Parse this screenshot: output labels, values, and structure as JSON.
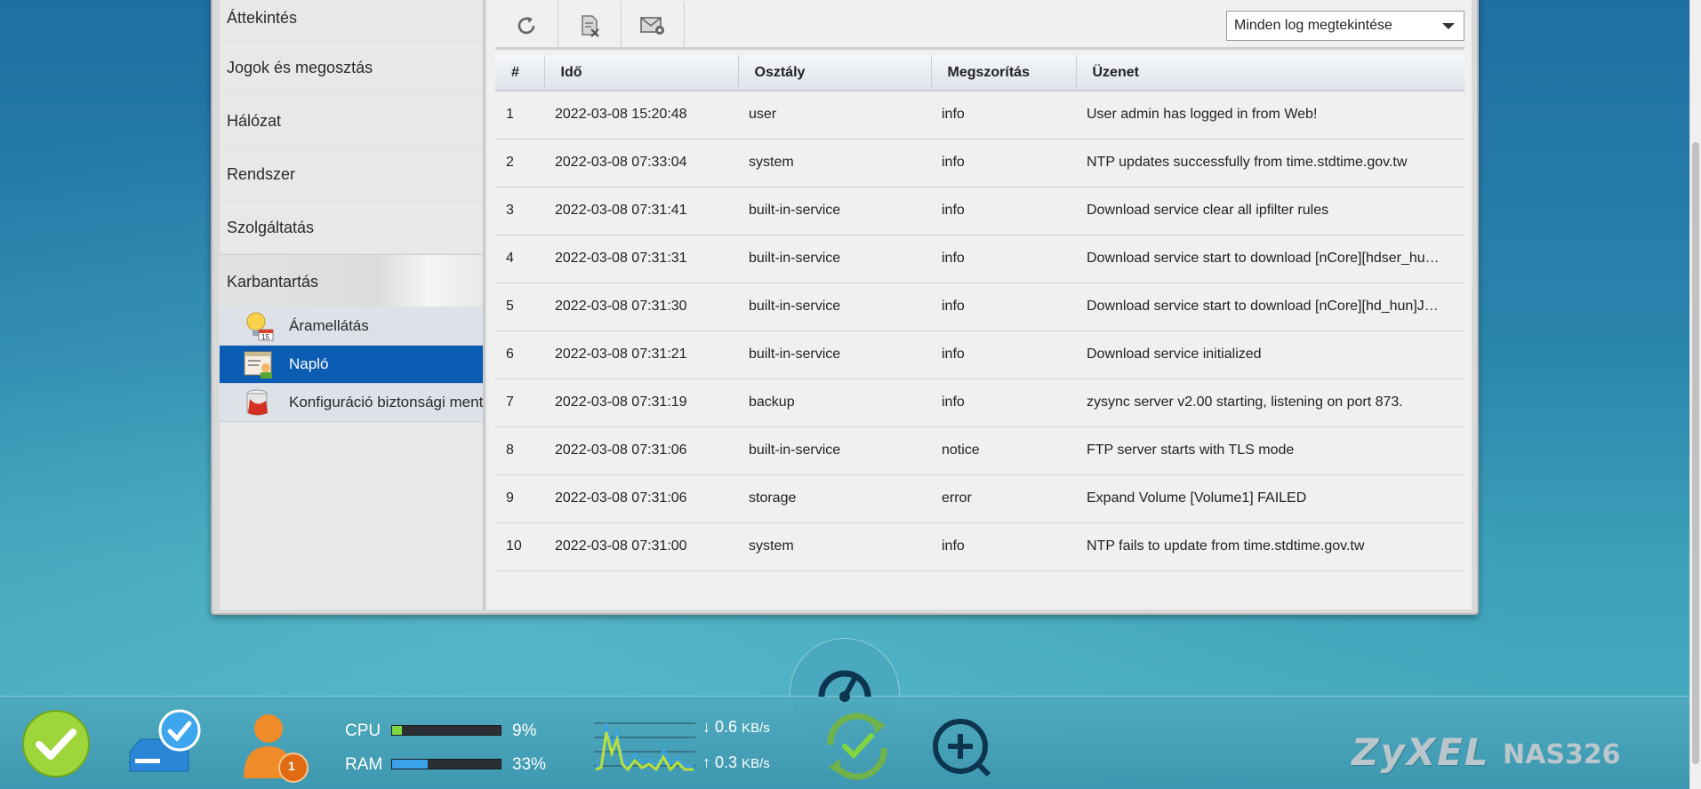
{
  "sidebar": {
    "items": [
      {
        "label": "Áttekintés"
      },
      {
        "label": "Jogok és megosztás"
      },
      {
        "label": "Hálózat"
      },
      {
        "label": "Rendszer"
      },
      {
        "label": "Szolgáltatás"
      },
      {
        "label": "Karbantartás"
      }
    ],
    "sub_items": [
      {
        "label": "Áramellátás",
        "icon": "power-bulb-icon"
      },
      {
        "label": "Napló",
        "icon": "log-icon",
        "selected": true
      },
      {
        "label": "Konfiguráció biztonsági mentése",
        "icon": "config-backup-icon"
      }
    ]
  },
  "toolbar": {
    "buttons": [
      {
        "icon": "refresh-icon"
      },
      {
        "icon": "clear-log-icon"
      },
      {
        "icon": "email-settings-icon"
      }
    ],
    "filter_select": {
      "value": "Minden log megtekintése"
    }
  },
  "log_table": {
    "headers": [
      "#",
      "Idő",
      "Osztály",
      "Megszorítás",
      "Üzenet"
    ],
    "rows": [
      [
        "1",
        "2022-03-08 15:20:48",
        "user",
        "info",
        "User admin has logged in from Web!"
      ],
      [
        "2",
        "2022-03-08 07:33:04",
        "system",
        "info",
        "NTP updates successfully from time.stdtime.gov.tw"
      ],
      [
        "3",
        "2022-03-08 07:31:41",
        "built-in-service",
        "info",
        "Download service clear all ipfilter rules"
      ],
      [
        "4",
        "2022-03-08 07:31:31",
        "built-in-service",
        "info",
        "Download service start to download [nCore][hdser_hu…"
      ],
      [
        "5",
        "2022-03-08 07:31:30",
        "built-in-service",
        "info",
        "Download service start to download [nCore][hd_hun]J…"
      ],
      [
        "6",
        "2022-03-08 07:31:21",
        "built-in-service",
        "info",
        "Download service initialized"
      ],
      [
        "7",
        "2022-03-08 07:31:19",
        "backup",
        "info",
        "zysync server v2.00 starting, listening on port 873."
      ],
      [
        "8",
        "2022-03-08 07:31:06",
        "built-in-service",
        "notice",
        "FTP server starts with TLS mode"
      ],
      [
        "9",
        "2022-03-08 07:31:06",
        "storage",
        "error",
        "Expand Volume [Volume1] FAILED"
      ],
      [
        "10",
        "2022-03-08 07:31:00",
        "system",
        "info",
        "NTP fails to update from time.stdtime.gov.tw"
      ]
    ]
  },
  "status_bar": {
    "cpu": {
      "label": "CPU",
      "value": "9%",
      "fraction": 0.09,
      "color": "#7fd63f"
    },
    "ram": {
      "label": "RAM",
      "value": "33%",
      "fraction": 0.33,
      "color": "#3aa2e8"
    },
    "download": {
      "value": "0.6",
      "unit": "KB/s"
    },
    "upload": {
      "value": "0.3",
      "unit": "KB/s"
    },
    "user_badge": "1",
    "brand": "ZyXEL",
    "model": "NAS326"
  }
}
